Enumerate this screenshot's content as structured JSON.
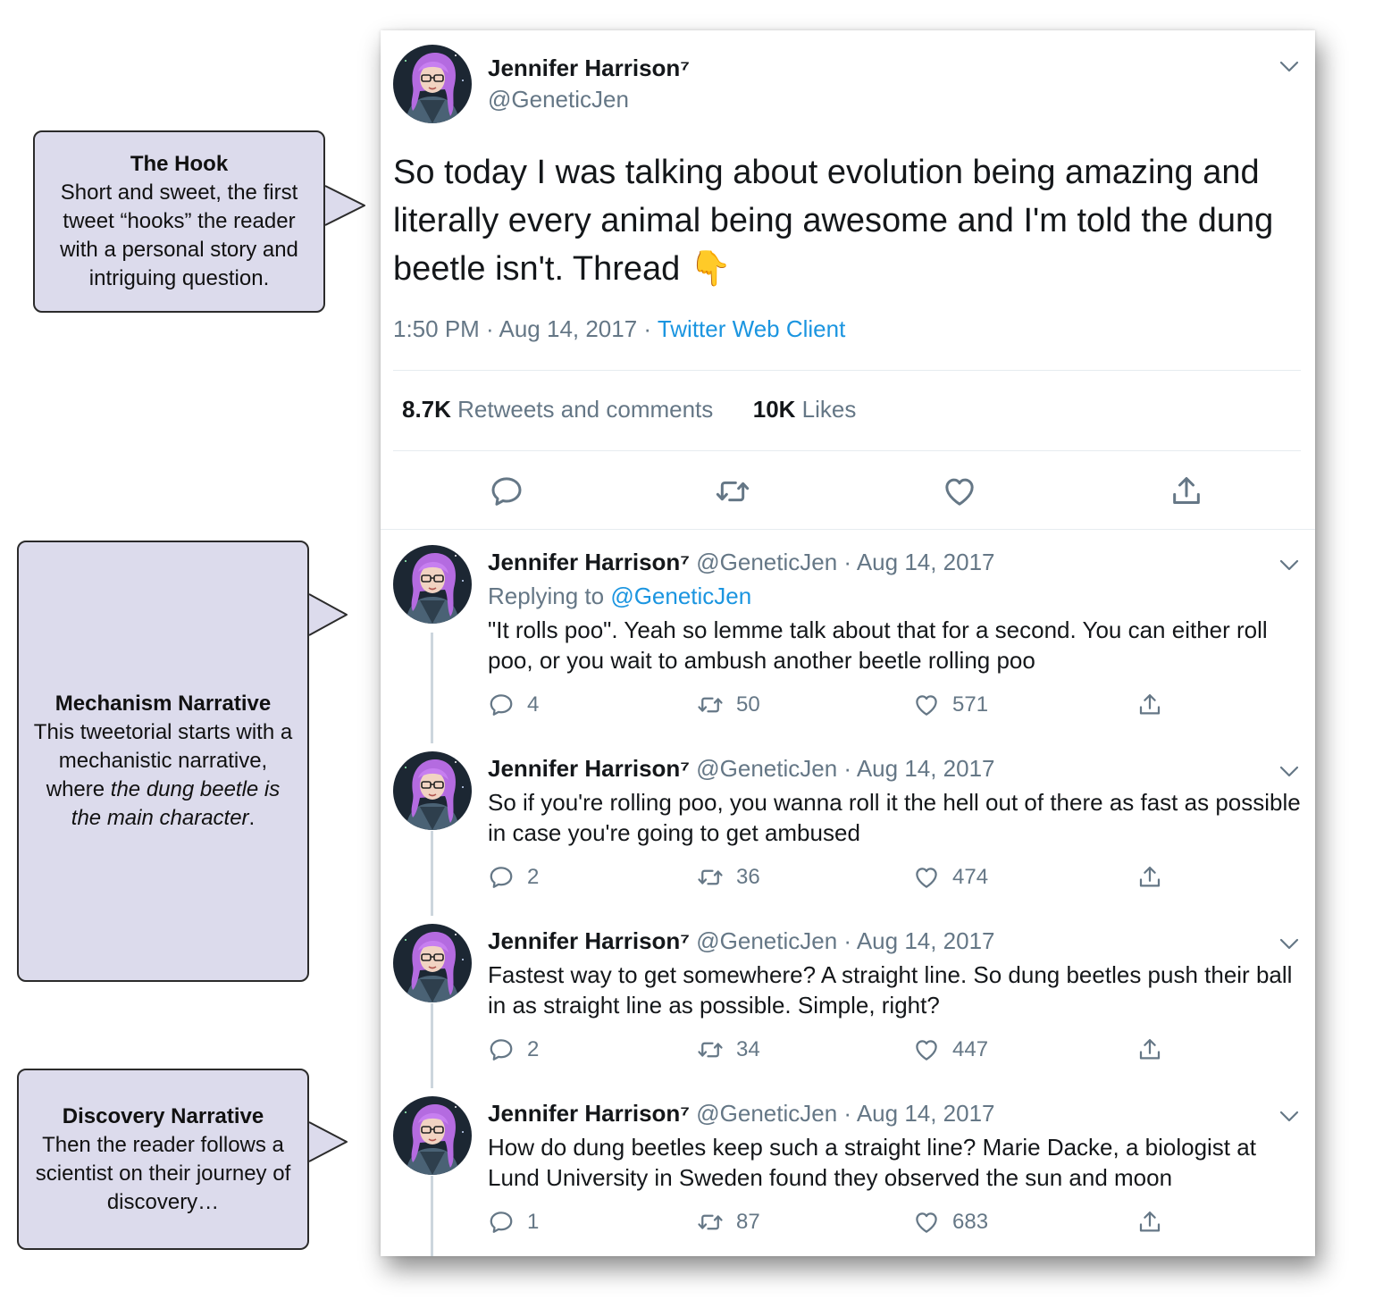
{
  "callouts": {
    "hook": {
      "title": "The Hook",
      "lines": [
        "Short and sweet, the first",
        "tweet “hooks” the reader",
        "with a personal story and",
        "intriguing question."
      ]
    },
    "mechanism": {
      "title": "Mechanism Narrative",
      "line1": "This tweetorial starts with a",
      "line2": "mechanistic narrative,",
      "line3_pre": "where ",
      "line3_em": "the dung beetle is",
      "line4_em": "the main character",
      "line4_post": "."
    },
    "discovery": {
      "title": "Discovery Narrative",
      "lines": [
        "Then the reader follows a",
        "scientist on their journey of",
        "discovery…"
      ]
    }
  },
  "main_tweet": {
    "name": "Jennifer Harrison⁷",
    "handle": "@GeneticJen",
    "text": "So today I was talking about evolution being amazing and literally every animal being awesome and I'm told the dung beetle isn't. Thread",
    "emoji": "👇",
    "time": "1:50 PM · Aug 14, 2017 · ",
    "source": "Twitter Web Client",
    "retweets_count": "8.7K",
    "retweets_label": " Retweets and comments",
    "likes_count": "10K",
    "likes_label": " Likes"
  },
  "replies": [
    {
      "name": "Jennifer Harrison⁷",
      "meta": " @GeneticJen · Aug 14, 2017",
      "replying_prefix": "Replying to ",
      "replying_handle": "@GeneticJen",
      "text": "\"It rolls poo\". Yeah so lemme talk about that for a second. You can either roll poo, or you wait to ambush another beetle rolling poo",
      "comments": "4",
      "retweets": "50",
      "likes": "571"
    },
    {
      "name": "Jennifer Harrison⁷",
      "meta": " @GeneticJen · Aug 14, 2017",
      "text": "So if you're rolling poo, you wanna roll it the hell out of there as fast as possible in case you're going to get ambused",
      "comments": "2",
      "retweets": "36",
      "likes": "474"
    },
    {
      "name": "Jennifer Harrison⁷",
      "meta": " @GeneticJen · Aug 14, 2017",
      "text": "Fastest way to get somewhere? A straight line. So dung beetles push their ball in as straight line as possible. Simple, right?",
      "comments": "2",
      "retweets": "34",
      "likes": "447"
    },
    {
      "name": "Jennifer Harrison⁷",
      "meta": " @GeneticJen · Aug 14, 2017",
      "text": "How do dung beetles keep such a straight line? Marie Dacke, a biologist at Lund University in Sweden found they observed the sun and moon",
      "comments": "1",
      "retweets": "87",
      "likes": "683"
    }
  ],
  "icons": {
    "comment": "comment-icon",
    "retweet": "retweet-icon",
    "like": "heart-icon",
    "share": "share-icon",
    "menu": "chevron-down-icon",
    "avatar": "avatar"
  },
  "colors": {
    "callout_fill": "#dcdbec",
    "link": "#1b95e0",
    "muted": "#657786",
    "text": "#14171a"
  }
}
